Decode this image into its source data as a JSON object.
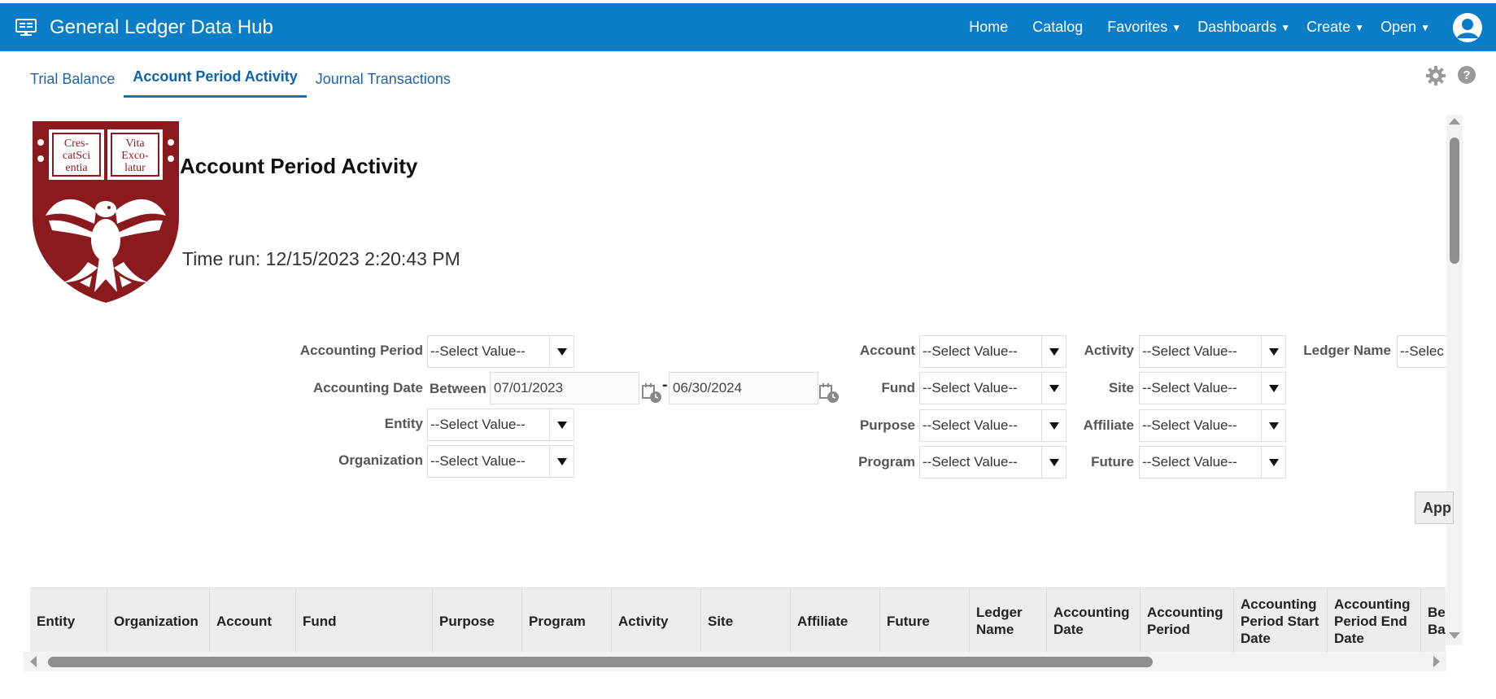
{
  "header": {
    "title": "General Ledger Data Hub",
    "nav": [
      {
        "label": "Home",
        "dropdown": false
      },
      {
        "label": "Catalog",
        "dropdown": false
      },
      {
        "label": "Favorites",
        "dropdown": true
      },
      {
        "label": "Dashboards",
        "dropdown": true
      },
      {
        "label": "Create",
        "dropdown": true
      },
      {
        "label": "Open",
        "dropdown": true
      }
    ],
    "brand_color": "#0a7dc9"
  },
  "tabs": [
    {
      "label": "Trial Balance",
      "active": false
    },
    {
      "label": "Account Period Activity",
      "active": true
    },
    {
      "label": "Journal Transactions",
      "active": false
    }
  ],
  "report": {
    "title": "Account Period Activity",
    "time_run": "Time run: 12/15/2023 2:20:43 PM",
    "logo": {
      "book_left": "Cres- catSci entia",
      "book_right": "Vita Exco- latur"
    }
  },
  "prompts": {
    "accounting_period": {
      "label": "Accounting Period",
      "value": "--Select Value--"
    },
    "accounting_date": {
      "label": "Accounting Date",
      "between_label": "Between",
      "start": "07/01/2023",
      "separator": "-",
      "end": "06/30/2024"
    },
    "entity": {
      "label": "Entity",
      "value": "--Select Value--"
    },
    "organization": {
      "label": "Organization",
      "value": "--Select Value--"
    },
    "account": {
      "label": "Account",
      "value": "--Select Value--"
    },
    "fund": {
      "label": "Fund",
      "value": "--Select Value--"
    },
    "purpose": {
      "label": "Purpose",
      "value": "--Select Value--"
    },
    "program": {
      "label": "Program",
      "value": "--Select Value--"
    },
    "activity": {
      "label": "Activity",
      "value": "--Select Value--"
    },
    "site": {
      "label": "Site",
      "value": "--Select Value--"
    },
    "affiliate": {
      "label": "Affiliate",
      "value": "--Select Value--"
    },
    "future": {
      "label": "Future",
      "value": "--Select Value--"
    },
    "ledger_name": {
      "label": "Ledger Name",
      "value": "--Selec"
    },
    "apply_label": "App"
  },
  "table": {
    "columns": [
      "Entity",
      "Organization",
      "Account",
      "Fund",
      "Purpose",
      "Program",
      "Activity",
      "Site",
      "Affiliate",
      "Future",
      "Ledger Name",
      "Accounting Date",
      "Accounting Period",
      "Accounting Period Start Date",
      "Accounting Period End Date",
      "Beginning Balance"
    ]
  },
  "colors": {
    "tab_active": "#0b62b1",
    "header_bg": "#0a7dc9",
    "logo_maroon": "#8b1a1e"
  }
}
